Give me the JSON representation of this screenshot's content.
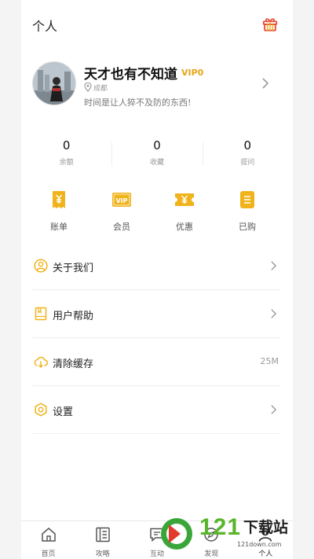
{
  "header": {
    "title": "个人",
    "gift_icon": "gift-icon"
  },
  "profile": {
    "name": "天才也有不知道",
    "vip": "VIP0",
    "location": "成都",
    "bio": "时间是让人猝不及防的东西!"
  },
  "stats": [
    {
      "value": "0",
      "label": "余额"
    },
    {
      "value": "0",
      "label": "收藏"
    },
    {
      "value": "0",
      "label": "提问"
    }
  ],
  "quick": [
    {
      "label": "账单",
      "icon": "bill-icon"
    },
    {
      "label": "会员",
      "icon": "vip-card-icon"
    },
    {
      "label": "优惠",
      "icon": "coupon-icon"
    },
    {
      "label": "已购",
      "icon": "purchased-icon"
    }
  ],
  "menu": [
    {
      "label": "关于我们",
      "icon": "user-circle-icon",
      "right": ""
    },
    {
      "label": "用户帮助",
      "icon": "book-icon",
      "right": ""
    },
    {
      "label": "清除缓存",
      "icon": "cloud-download-icon",
      "right": "25M"
    },
    {
      "label": "设置",
      "icon": "settings-icon",
      "right": ""
    }
  ],
  "tabs": [
    {
      "label": "首页",
      "icon": "home-icon"
    },
    {
      "label": "攻略",
      "icon": "guide-icon"
    },
    {
      "label": "互动",
      "icon": "chat-icon"
    },
    {
      "label": "发现",
      "icon": "discover-icon"
    },
    {
      "label": "个人",
      "icon": "profile-icon"
    }
  ],
  "watermark": {
    "number": "121",
    "text": "下载站",
    "url": "121down.com"
  },
  "colors": {
    "accent": "#f0b31c",
    "vip": "#e6a514",
    "watermark_green": "#59b52a"
  }
}
